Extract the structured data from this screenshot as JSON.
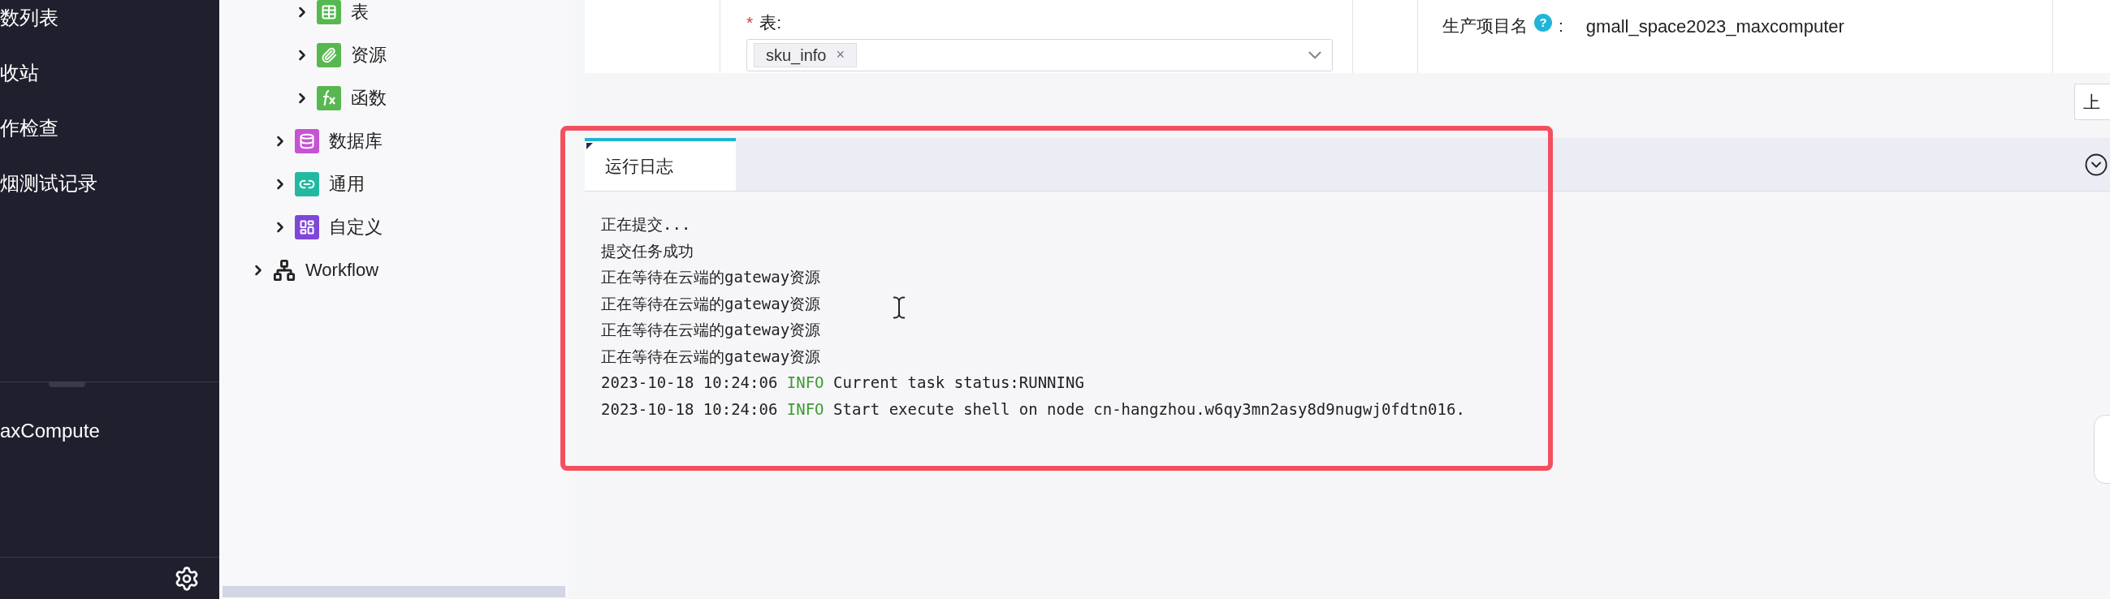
{
  "sidebar": {
    "items": [
      {
        "label": "数列表"
      },
      {
        "label": "收站"
      },
      {
        "label": "作检查"
      },
      {
        "label": "烟测试记录"
      }
    ],
    "bottom_item": {
      "label": "axCompute"
    }
  },
  "tree": [
    {
      "children": [
        {
          "children": [
            {
              "label": "表",
              "kind": "table",
              "expanded": false
            },
            {
              "label": "资源",
              "kind": "resource",
              "expanded": false
            },
            {
              "label": "函数",
              "kind": "function",
              "expanded": false
            }
          ]
        },
        {
          "label": "数据库",
          "kind": "database",
          "expanded": false
        },
        {
          "label": "通用",
          "kind": "common",
          "expanded": false
        },
        {
          "label": "自定义",
          "kind": "custom",
          "expanded": false
        }
      ]
    },
    {
      "label": "Workflow",
      "kind": "workflow",
      "expanded": false
    }
  ],
  "form": {
    "table_field": {
      "label": "表:",
      "required_mark": "*",
      "tags": [
        "sku_info"
      ],
      "remove_mark": "×"
    },
    "project": {
      "label": "生产项目名",
      "help_mark": "?",
      "separator": ":",
      "value": "gmall_space2023_maxcomputer"
    }
  },
  "cut_button": {
    "label": "上"
  },
  "log_panel": {
    "tabs": [
      {
        "label": "运行日志",
        "selected": true
      }
    ],
    "lines": [
      {
        "kind": "plain",
        "text": "正在提交..."
      },
      {
        "kind": "plain",
        "text": "提交任务成功"
      },
      {
        "kind": "plain",
        "text": "正在等待在云端的gateway资源"
      },
      {
        "kind": "plain",
        "text": "正在等待在云端的gateway资源"
      },
      {
        "kind": "plain",
        "text": "正在等待在云端的gateway资源"
      },
      {
        "kind": "plain",
        "text": "正在等待在云端的gateway资源"
      },
      {
        "kind": "info",
        "time": "2023-10-18 10:24:06",
        "level": "INFO",
        "message": "Current task status:RUNNING"
      },
      {
        "kind": "info",
        "time": "2023-10-18 10:24:06",
        "level": "INFO",
        "message": "Start execute shell on node cn-hangzhou.w6qy3mn2asy8d9nugwj0fdtn016."
      }
    ]
  }
}
